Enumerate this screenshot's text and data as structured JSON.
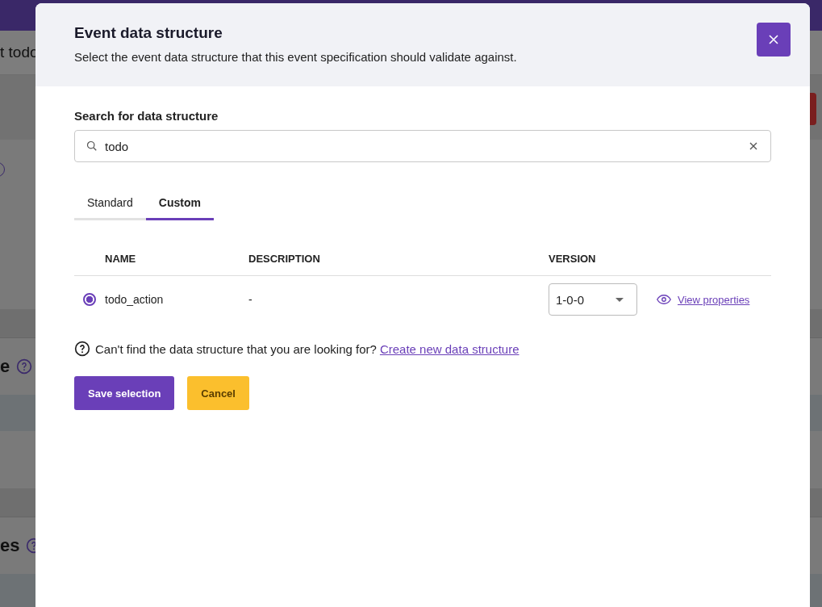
{
  "background": {
    "header_text": "t todo",
    "section_titles": [
      {
        "text": "e"
      },
      {
        "text": "es"
      }
    ]
  },
  "dialog": {
    "title": "Event data structure",
    "subtitle": "Select the event data structure that this event specification should validate against.",
    "search": {
      "label": "Search for data structure",
      "value": "todo"
    },
    "tabs": [
      {
        "label": "Standard",
        "selected": false
      },
      {
        "label": "Custom",
        "selected": true
      }
    ],
    "table": {
      "columns": [
        "NAME",
        "DESCRIPTION",
        "VERSION"
      ],
      "rows": [
        {
          "selected": true,
          "name": "todo_action",
          "description": "-",
          "version": "1-0-0",
          "action": "View properties"
        }
      ]
    },
    "help": {
      "text": "Can't find the data structure that you are looking for?",
      "link": "Create new data structure"
    },
    "buttons": [
      {
        "label": "Save selection",
        "kind": "primary"
      },
      {
        "label": "Cancel",
        "kind": "secondary"
      }
    ]
  }
}
